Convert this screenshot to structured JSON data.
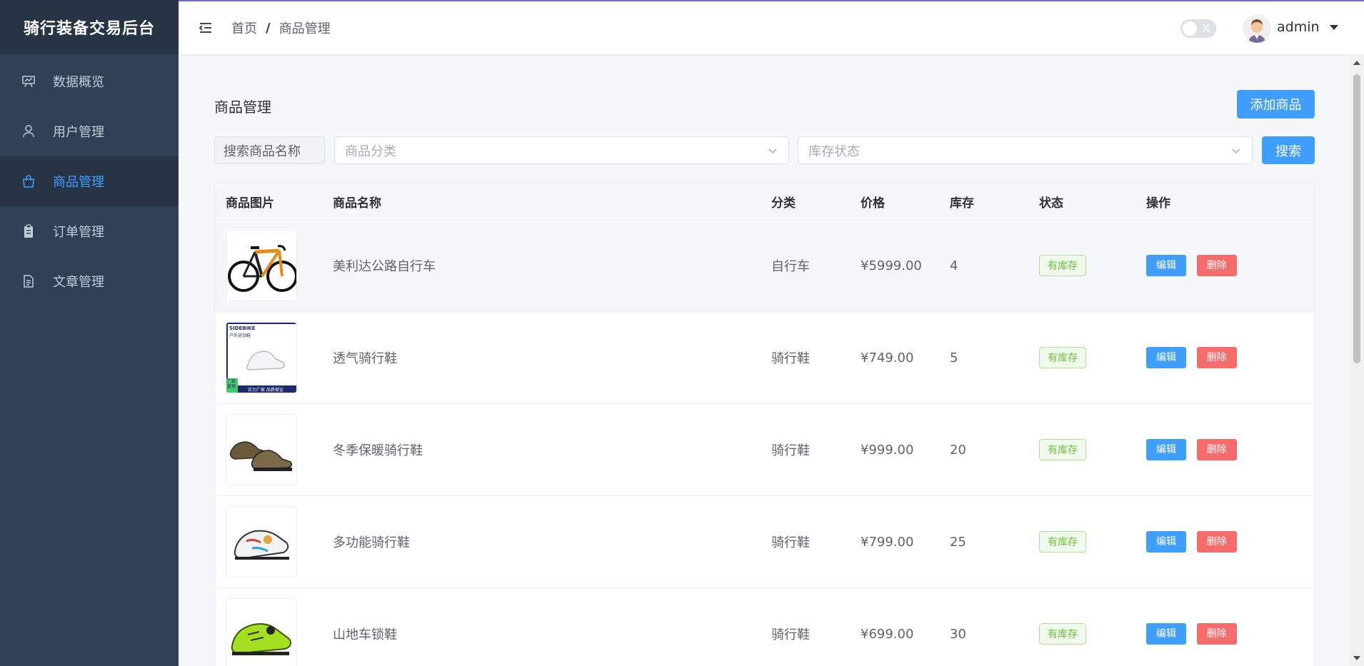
{
  "app": {
    "title": "骑行装备交易后台"
  },
  "colors": {
    "sidebar_bg": "#304156",
    "sidebar_active_bg": "#263445",
    "primary": "#409eff",
    "danger": "#f56c6c",
    "success": "#67c23a"
  },
  "sidebar": {
    "items": [
      {
        "label": "数据概览",
        "icon": "dashboard-chart-icon",
        "active": false
      },
      {
        "label": "用户管理",
        "icon": "user-icon",
        "active": false
      },
      {
        "label": "商品管理",
        "icon": "shopping-bag-icon",
        "active": true
      },
      {
        "label": "订单管理",
        "icon": "clipboard-icon",
        "active": false
      },
      {
        "label": "文章管理",
        "icon": "document-icon",
        "active": false
      }
    ]
  },
  "header": {
    "breadcrumb": [
      "首页",
      "商品管理"
    ],
    "breadcrumb_sep": "/",
    "toggle_label": "关",
    "username": "admin"
  },
  "page": {
    "title": "商品管理",
    "add_button": "添加商品",
    "search": {
      "name_label": "搜索商品名称",
      "category_placeholder": "商品分类",
      "stock_placeholder": "库存状态",
      "search_button": "搜索"
    }
  },
  "table": {
    "headers": [
      "商品图片",
      "商品名称",
      "分类",
      "价格",
      "库存",
      "状态",
      "操作"
    ],
    "edit_label": "编辑",
    "delete_label": "删除",
    "rows": [
      {
        "name": "美利达公路自行车",
        "category": "自行车",
        "price": "¥5999.00",
        "stock": "4",
        "status": "有库存",
        "image": "road-bike"
      },
      {
        "name": "透气骑行鞋",
        "category": "骑行鞋",
        "price": "¥749.00",
        "stock": "5",
        "status": "有库存",
        "image": "white-shoe-ad",
        "image_text": {
          "brand": "SIDEBIKE",
          "line": "户外运动鞋",
          "corner": "厂家直销",
          "footer": "实力厂家 品质保证"
        }
      },
      {
        "name": "冬季保暖骑行鞋",
        "category": "骑行鞋",
        "price": "¥999.00",
        "stock": "20",
        "status": "有库存",
        "image": "brown-shoes"
      },
      {
        "name": "多功能骑行鞋",
        "category": "骑行鞋",
        "price": "¥799.00",
        "stock": "25",
        "status": "有库存",
        "image": "colorful-shoe"
      },
      {
        "name": "山地车锁鞋",
        "category": "骑行鞋",
        "price": "¥699.00",
        "stock": "30",
        "status": "有库存",
        "image": "green-shoe"
      }
    ]
  }
}
